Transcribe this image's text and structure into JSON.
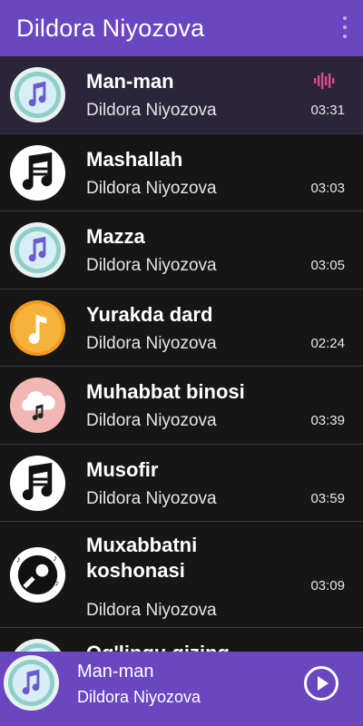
{
  "app": {
    "title": "Dildora Niyozova"
  },
  "songs": [
    {
      "title": "Man-man",
      "artist": "Dildora Niyozova",
      "duration": "03:31",
      "icon": "music-note-teal-icon",
      "playing": true
    },
    {
      "title": "Mashallah",
      "artist": "Dildora Niyozova",
      "duration": "03:03",
      "icon": "music-notes-bw-icon"
    },
    {
      "title": "Mazza",
      "artist": "Dildora Niyozova",
      "duration": "03:05",
      "icon": "music-note-teal-icon"
    },
    {
      "title": "Yurakda dard",
      "artist": "Dildora Niyozova",
      "duration": "02:24",
      "icon": "music-note-orange-icon"
    },
    {
      "title": "Muhabbat binosi",
      "artist": "Dildora Niyozova",
      "duration": "03:39",
      "icon": "cloud-music-icon"
    },
    {
      "title": "Musofir",
      "artist": "Dildora Niyozova",
      "duration": "03:59",
      "icon": "music-notes-bw-icon"
    },
    {
      "title": "Muxabbatni koshonasi",
      "artist": "Dildora Niyozova",
      "duration": "03:09",
      "icon": "microphone-icon"
    },
    {
      "title": "Og'lingu qizing",
      "artist": "",
      "duration": "",
      "icon": "music-note-teal-icon"
    }
  ],
  "now_playing": {
    "title": "Man-man",
    "artist": "Dildora Niyozova",
    "icon": "music-note-teal-icon"
  },
  "colors": {
    "accent": "#6b46c1",
    "equalizer": "#e0458f",
    "background": "#161616"
  }
}
